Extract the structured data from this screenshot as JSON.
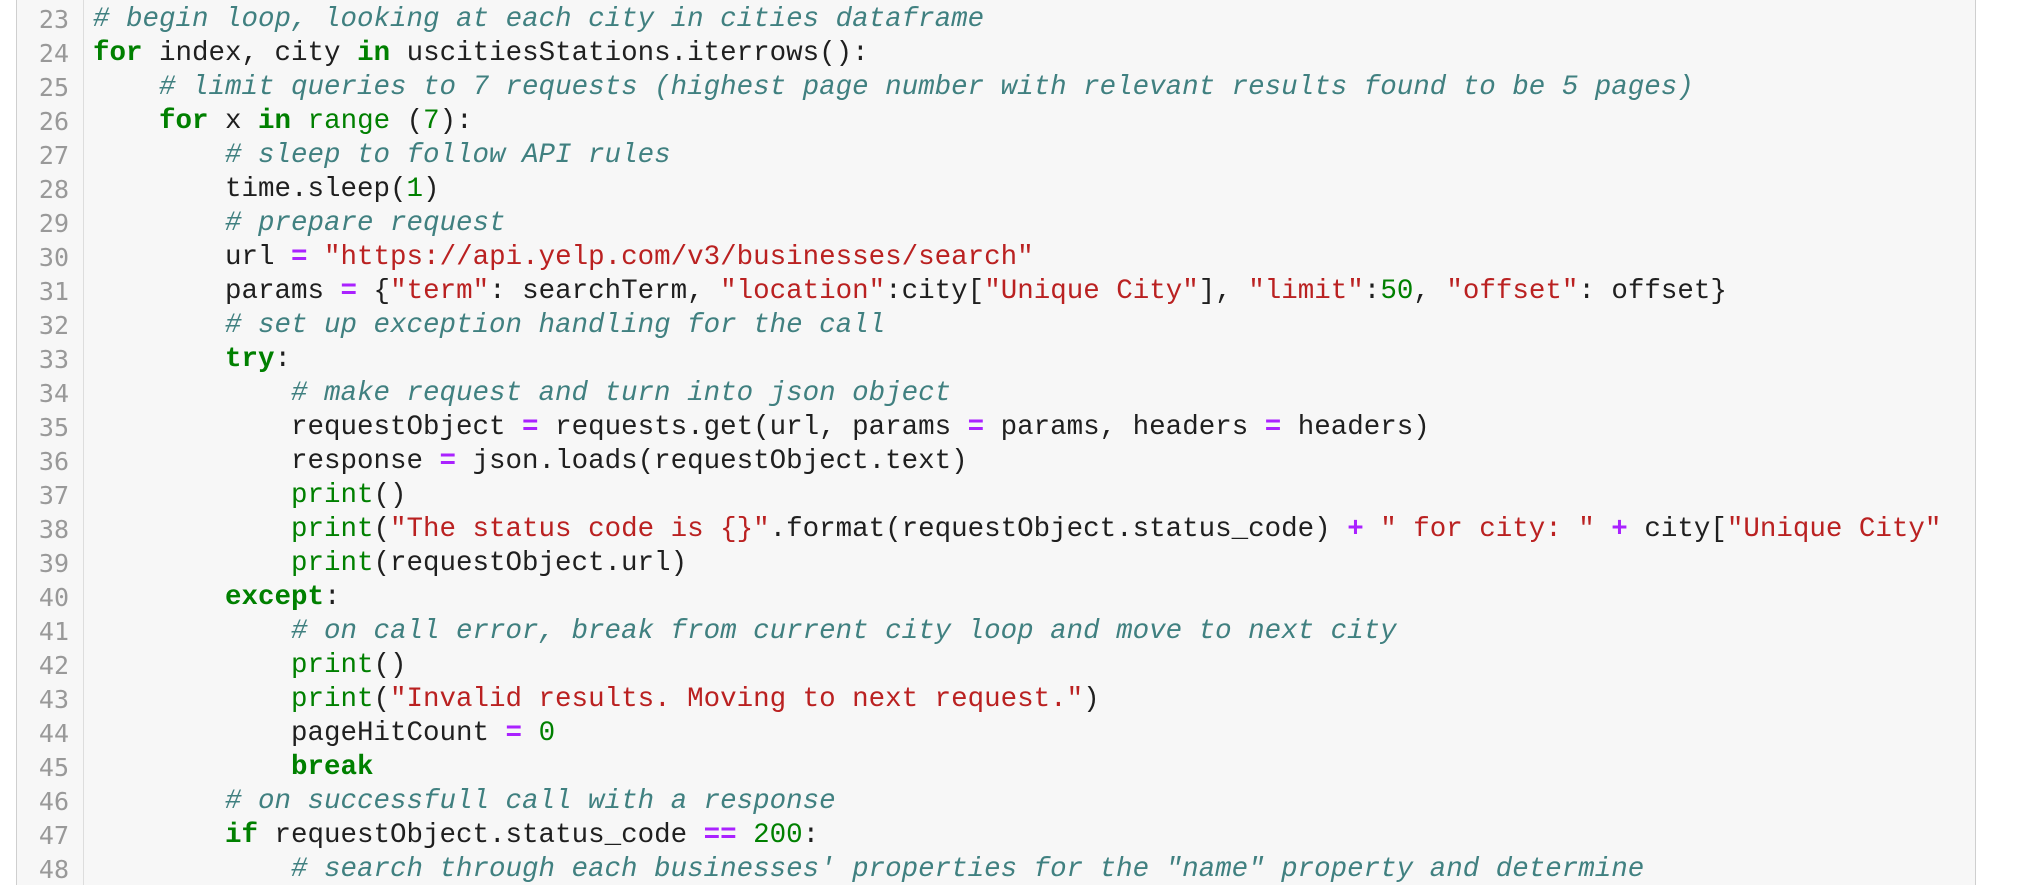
{
  "editor": {
    "colors": {
      "background": "#f7f7f7",
      "line_number": "#999999",
      "comment": "#408080",
      "keyword": "#008000",
      "string": "#ba2121",
      "builtin": "#008000",
      "number": "#008000",
      "operator": "#aa22ff",
      "plain": "#1f1f1f"
    },
    "lines": [
      {
        "n": "23",
        "indent": 0,
        "tokens": [
          {
            "t": "c",
            "v": "# begin loop, looking at each city in cities dataframe"
          }
        ]
      },
      {
        "n": "24",
        "indent": 0,
        "tokens": [
          {
            "t": "k",
            "v": "for"
          },
          {
            "t": "p",
            "v": " index, city "
          },
          {
            "t": "k",
            "v": "in"
          },
          {
            "t": "p",
            "v": " uscitiesStations.iterrows():"
          }
        ]
      },
      {
        "n": "25",
        "indent": 4,
        "tokens": [
          {
            "t": "c",
            "v": "# limit queries to 7 requests (highest page number with relevant results found to be 5 pages)"
          }
        ]
      },
      {
        "n": "26",
        "indent": 4,
        "tokens": [
          {
            "t": "k",
            "v": "for"
          },
          {
            "t": "p",
            "v": " x "
          },
          {
            "t": "k",
            "v": "in"
          },
          {
            "t": "p",
            "v": " "
          },
          {
            "t": "b",
            "v": "range"
          },
          {
            "t": "p",
            "v": " ("
          },
          {
            "t": "n",
            "v": "7"
          },
          {
            "t": "p",
            "v": "):"
          }
        ]
      },
      {
        "n": "27",
        "indent": 8,
        "tokens": [
          {
            "t": "c",
            "v": "# sleep to follow API rules"
          }
        ]
      },
      {
        "n": "28",
        "indent": 8,
        "tokens": [
          {
            "t": "p",
            "v": "time.sleep("
          },
          {
            "t": "n",
            "v": "1"
          },
          {
            "t": "p",
            "v": ")"
          }
        ]
      },
      {
        "n": "29",
        "indent": 8,
        "tokens": [
          {
            "t": "c",
            "v": "# prepare request"
          }
        ]
      },
      {
        "n": "30",
        "indent": 8,
        "tokens": [
          {
            "t": "p",
            "v": "url "
          },
          {
            "t": "o",
            "v": "="
          },
          {
            "t": "p",
            "v": " "
          },
          {
            "t": "s",
            "v": "\"https://api.yelp.com/v3/businesses/search\""
          }
        ]
      },
      {
        "n": "31",
        "indent": 8,
        "tokens": [
          {
            "t": "p",
            "v": "params "
          },
          {
            "t": "o",
            "v": "="
          },
          {
            "t": "p",
            "v": " {"
          },
          {
            "t": "s",
            "v": "\"term\""
          },
          {
            "t": "p",
            "v": ": searchTerm, "
          },
          {
            "t": "s",
            "v": "\"location\""
          },
          {
            "t": "p",
            "v": ":city["
          },
          {
            "t": "s",
            "v": "\"Unique City\""
          },
          {
            "t": "p",
            "v": "], "
          },
          {
            "t": "s",
            "v": "\"limit\""
          },
          {
            "t": "p",
            "v": ":"
          },
          {
            "t": "n",
            "v": "50"
          },
          {
            "t": "p",
            "v": ", "
          },
          {
            "t": "s",
            "v": "\"offset\""
          },
          {
            "t": "p",
            "v": ": offset}"
          }
        ]
      },
      {
        "n": "32",
        "indent": 8,
        "tokens": [
          {
            "t": "c",
            "v": "# set up exception handling for the call"
          }
        ]
      },
      {
        "n": "33",
        "indent": 8,
        "tokens": [
          {
            "t": "k",
            "v": "try"
          },
          {
            "t": "p",
            "v": ":"
          }
        ]
      },
      {
        "n": "34",
        "indent": 12,
        "tokens": [
          {
            "t": "c",
            "v": "# make request and turn into json object"
          }
        ]
      },
      {
        "n": "35",
        "indent": 12,
        "tokens": [
          {
            "t": "p",
            "v": "requestObject "
          },
          {
            "t": "o",
            "v": "="
          },
          {
            "t": "p",
            "v": " requests.get(url, params "
          },
          {
            "t": "o",
            "v": "="
          },
          {
            "t": "p",
            "v": " params, headers "
          },
          {
            "t": "o",
            "v": "="
          },
          {
            "t": "p",
            "v": " headers)"
          }
        ]
      },
      {
        "n": "36",
        "indent": 12,
        "tokens": [
          {
            "t": "p",
            "v": "response "
          },
          {
            "t": "o",
            "v": "="
          },
          {
            "t": "p",
            "v": " json.loads(requestObject.text)"
          }
        ]
      },
      {
        "n": "37",
        "indent": 12,
        "tokens": [
          {
            "t": "b",
            "v": "print"
          },
          {
            "t": "p",
            "v": "()"
          }
        ]
      },
      {
        "n": "38",
        "indent": 12,
        "tokens": [
          {
            "t": "b",
            "v": "print"
          },
          {
            "t": "p",
            "v": "("
          },
          {
            "t": "s",
            "v": "\"The status code is {}\""
          },
          {
            "t": "p",
            "v": ".format(requestObject.status_code) "
          },
          {
            "t": "o",
            "v": "+"
          },
          {
            "t": "p",
            "v": " "
          },
          {
            "t": "s",
            "v": "\" for city: \""
          },
          {
            "t": "p",
            "v": " "
          },
          {
            "t": "o",
            "v": "+"
          },
          {
            "t": "p",
            "v": " city["
          },
          {
            "t": "s",
            "v": "\"Unique City\""
          }
        ]
      },
      {
        "n": "39",
        "indent": 12,
        "tokens": [
          {
            "t": "b",
            "v": "print"
          },
          {
            "t": "p",
            "v": "(requestObject.url)"
          }
        ]
      },
      {
        "n": "40",
        "indent": 8,
        "tokens": [
          {
            "t": "k",
            "v": "except"
          },
          {
            "t": "p",
            "v": ":"
          }
        ]
      },
      {
        "n": "41",
        "indent": 12,
        "tokens": [
          {
            "t": "c",
            "v": "# on call error, break from current city loop and move to next city"
          }
        ]
      },
      {
        "n": "42",
        "indent": 12,
        "tokens": [
          {
            "t": "b",
            "v": "print"
          },
          {
            "t": "p",
            "v": "()"
          }
        ]
      },
      {
        "n": "43",
        "indent": 12,
        "tokens": [
          {
            "t": "b",
            "v": "print"
          },
          {
            "t": "p",
            "v": "("
          },
          {
            "t": "s",
            "v": "\"Invalid results. Moving to next request.\""
          },
          {
            "t": "p",
            "v": ")"
          }
        ]
      },
      {
        "n": "44",
        "indent": 12,
        "tokens": [
          {
            "t": "p",
            "v": "pageHitCount "
          },
          {
            "t": "o",
            "v": "="
          },
          {
            "t": "p",
            "v": " "
          },
          {
            "t": "n",
            "v": "0"
          }
        ]
      },
      {
        "n": "45",
        "indent": 12,
        "tokens": [
          {
            "t": "k",
            "v": "break"
          }
        ]
      },
      {
        "n": "46",
        "indent": 8,
        "tokens": [
          {
            "t": "c",
            "v": "# on successfull call with a response"
          }
        ]
      },
      {
        "n": "47",
        "indent": 8,
        "tokens": [
          {
            "t": "k",
            "v": "if"
          },
          {
            "t": "p",
            "v": " requestObject.status_code "
          },
          {
            "t": "o",
            "v": "=="
          },
          {
            "t": "p",
            "v": " "
          },
          {
            "t": "n",
            "v": "200"
          },
          {
            "t": "p",
            "v": ":"
          }
        ]
      },
      {
        "n": "48",
        "indent": 12,
        "tokens": [
          {
            "t": "c",
            "v": "# search through each businesses' properties for the \"name\" property and determine"
          }
        ]
      }
    ]
  }
}
